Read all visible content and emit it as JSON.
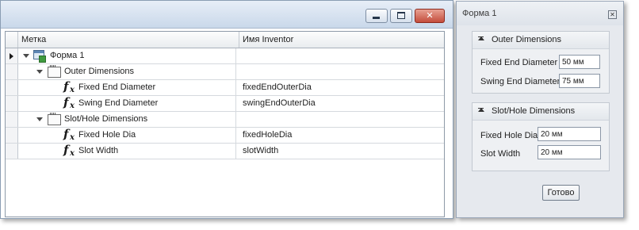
{
  "tree": {
    "headers": {
      "label": "Метка",
      "inventor_name": "Имя Inventor"
    },
    "rows": [
      {
        "label": "Форма 1",
        "name": "",
        "icon": "form-icon"
      },
      {
        "label": "Outer Dimensions",
        "name": "",
        "icon": "group-icon"
      },
      {
        "label": "Fixed End Diameter",
        "name": "fixedEndOuterDia",
        "icon": "fx-icon"
      },
      {
        "label": "Swing End Diameter",
        "name": "swingEndOuterDia",
        "icon": "fx-icon"
      },
      {
        "label": "Slot/Hole Dimensions",
        "name": "",
        "icon": "group-icon"
      },
      {
        "label": "Fixed Hole Dia",
        "name": "fixedHoleDia",
        "icon": "fx-icon"
      },
      {
        "label": "Slot Width",
        "name": "slotWidth",
        "icon": "fx-icon"
      }
    ]
  },
  "form": {
    "title": "Форма 1",
    "outer": {
      "header": "Outer Dimensions",
      "fixed_label": "Fixed End Diameter",
      "fixed_value": "50 мм",
      "swing_label": "Swing End Diameter",
      "swing_value": "75 мм"
    },
    "slot": {
      "header": "Slot/Hole Dimensions",
      "hole_label": "Fixed Hole Dia",
      "hole_value": "20 мм",
      "width_label": "Slot Width",
      "width_value": "20 мм"
    },
    "done_label": "Готово"
  },
  "colors": {
    "close_button": "#c44d3c",
    "title_gradient_top": "#e7eef7",
    "fx_icon": "#1a1a1a"
  }
}
